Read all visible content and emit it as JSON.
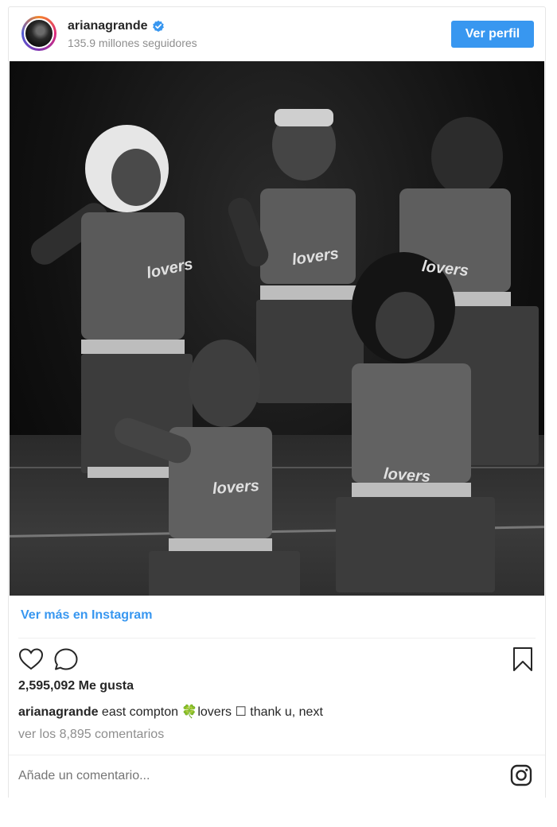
{
  "post": {
    "username": "arianagrande",
    "followers": "135.9 millones seguidores",
    "view_profile_label": "Ver perfil",
    "more_link": "Ver más en Instagram",
    "likes": "2,595,092 Me gusta",
    "caption_user": "arianagrande",
    "caption_text": " east compton 🍀lovers ☐ thank u, next",
    "comments_link": "ver los 8,895 comentarios",
    "add_comment_placeholder": "Añade un comentario...",
    "photo_jersey_text": "lovers"
  },
  "icons": {
    "verified": "verified-badge-icon",
    "like": "heart-icon",
    "comment": "comment-bubble-icon",
    "save": "bookmark-icon",
    "instagram": "instagram-logo-icon"
  },
  "colors": {
    "accent": "#3897f0",
    "text": "#262626",
    "secondary": "#8e8e8e"
  }
}
